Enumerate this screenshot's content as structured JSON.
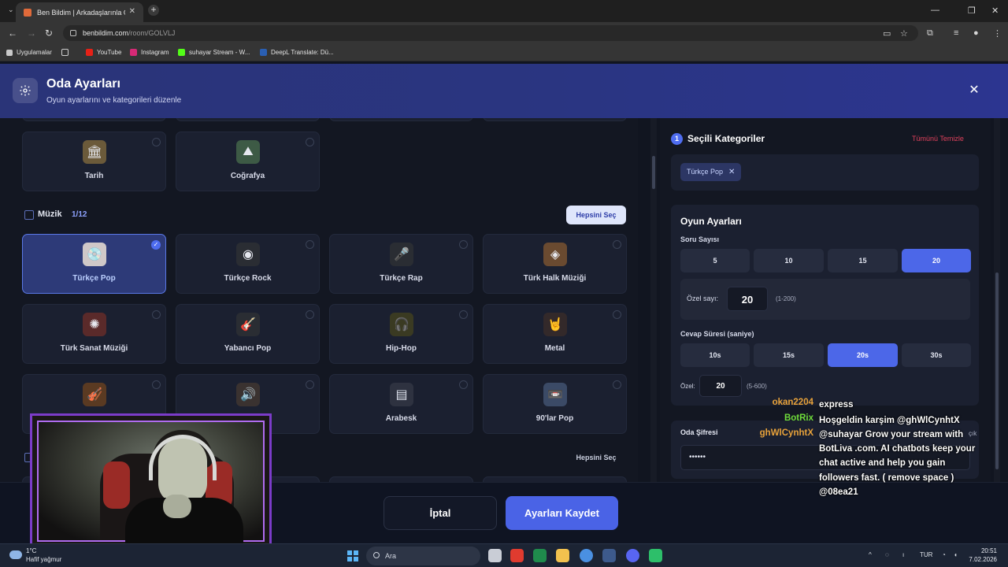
{
  "browser": {
    "tab_title": "Ben Bildim | Arkadaşlarınla Onli",
    "url_host": "benbildim.com",
    "url_path": "/room/GOLVLJ",
    "bookmarks": [
      "Uygulamalar",
      "YouTube",
      "Instagram",
      "suhayar Stream - W...",
      "DeepL Translate: Dü..."
    ]
  },
  "modal": {
    "title": "Oda Ayarları",
    "subtitle": "Oyun ayarlarını ve kategorileri düzenle"
  },
  "categories": {
    "general_cards": [
      "Tarih",
      "Coğrafya"
    ],
    "music": {
      "title": "Müzik",
      "count": "1/12",
      "select_all": "Hepsini Seç",
      "cards": [
        "Türkçe Pop",
        "Türkçe Rock",
        "Türkçe Rap",
        "Türk Halk Müziği",
        "Türk Sanat Müziği",
        "Yabancı Pop",
        "Hip-Hop",
        "Metal",
        "Arabesk",
        "90'lar Pop"
      ]
    },
    "next_select_all": "Hepsini Seç"
  },
  "selected": {
    "number": "1",
    "title": "Seçili Kategoriler",
    "clear_all": "Tümünü Temizle",
    "chips": [
      "Türkçe Pop"
    ]
  },
  "game_settings": {
    "title": "Oyun Ayarları",
    "question_count_label": "Soru Sayısı",
    "question_options": [
      "5",
      "10",
      "15",
      "20"
    ],
    "question_selected": "20",
    "custom_label": "Özel sayı:",
    "custom_value": "20",
    "custom_range": "(1-200)",
    "answer_time_label": "Cevap Süresi (saniye)",
    "time_options": [
      "10s",
      "15s",
      "20s",
      "30s"
    ],
    "time_selected": "20s",
    "custom_time_label": "Özel:",
    "custom_time_value": "20",
    "custom_time_range": "(5-600)"
  },
  "password": {
    "title": "Oda Şifresi",
    "value": "••••••",
    "note": "çık"
  },
  "footer": {
    "cancel": "İptal",
    "save": "Ayarları Kaydet"
  },
  "chat": [
    {
      "user": "okan2204",
      "color": "#e8a23a",
      "message": "express"
    },
    {
      "user": "BotRix",
      "color": "#6fdc3a",
      "message": "Hoşgeldin karşim @ghWlCynhtX"
    },
    {
      "user": "ghWlCynhtX",
      "color": "#e8a23a",
      "message": "@suhayar Grow your stream with BotLiva .com. AI chatbots keep your chat active and help you gain followers fast. ( remove space ) @08ea21"
    }
  ],
  "taskbar": {
    "weather_temp": "1°C",
    "weather_desc": "Hafif yağmur",
    "search": "Ara",
    "lang": "TUR",
    "time": "20:51",
    "date": "7.02.2026"
  }
}
